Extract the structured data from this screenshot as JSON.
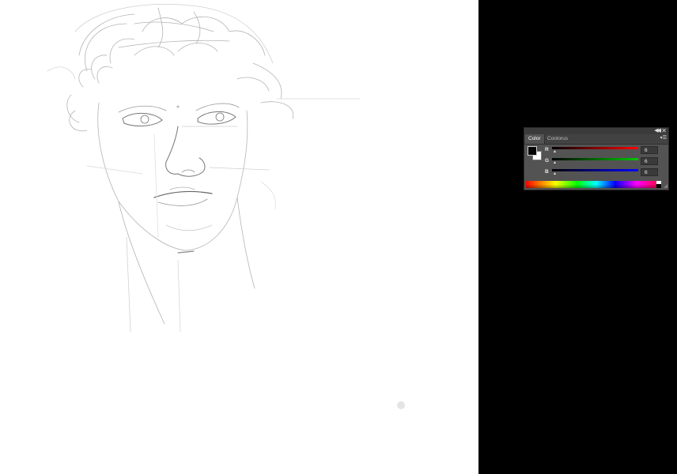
{
  "panel": {
    "tabs": [
      {
        "label": "Color",
        "active": true
      },
      {
        "label": "Coolorus",
        "active": false
      }
    ],
    "channels": [
      {
        "label": "R",
        "value": "6",
        "color": "#ff0000"
      },
      {
        "label": "G",
        "value": "6",
        "color": "#00c800"
      },
      {
        "label": "B",
        "value": "6",
        "color": "#0000ff"
      }
    ],
    "foreground_color": "#060606",
    "background_color": "#ffffff"
  },
  "icons": {
    "collapse": "double-chevron-left-icon",
    "close": "close-icon",
    "menu": "panel-menu-icon",
    "thumb": "slider-thumb-icon"
  }
}
